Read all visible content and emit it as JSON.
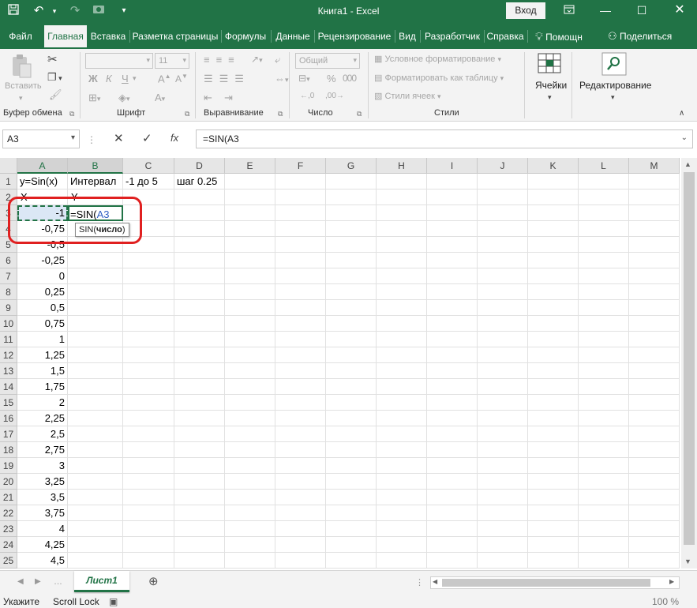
{
  "titlebar": {
    "title": "Книга1  -  Excel",
    "login": "Вход"
  },
  "tabs": [
    "Файл",
    "Главная",
    "Вставка",
    "Разметка страницы",
    "Формулы",
    "Данные",
    "Рецензирование",
    "Вид",
    "Разработчик",
    "Справка",
    "Помощн",
    "Поделиться"
  ],
  "ribbon": {
    "paste": "Вставить",
    "clipboard": "Буфер обмена",
    "font_size": "11",
    "font": "Шрифт",
    "alignment": "Выравнивание",
    "number_format": "Общий",
    "number": "Число",
    "cond_format": "Условное форматирование",
    "format_table": "Форматировать как таблицу",
    "cell_styles": "Стили ячеек",
    "styles": "Стили",
    "cells": "Ячейки",
    "editing": "Редактирование"
  },
  "formula_bar": {
    "name_box": "A3",
    "formula": "=SIN(A3"
  },
  "columns": [
    "A",
    "B",
    "C",
    "D",
    "E",
    "F",
    "G",
    "H",
    "I",
    "J",
    "K",
    "L",
    "M"
  ],
  "rows": [
    "1",
    "2",
    "3",
    "4",
    "5",
    "6",
    "7",
    "8",
    "9",
    "10",
    "11",
    "12",
    "13",
    "14",
    "15",
    "16",
    "17",
    "18",
    "19",
    "20",
    "21",
    "22",
    "23",
    "24",
    "25"
  ],
  "cells": {
    "r1": {
      "a": "y=Sin(x)",
      "b": "Интервал",
      "c": "-1 до 5",
      "d": "шаг 0.25"
    },
    "r2": {
      "a": "X",
      "b": "Y"
    },
    "a_values": [
      "-1",
      "-0,75",
      "-0,5",
      "-0,25",
      "0",
      "0,25",
      "0,5",
      "0,75",
      "1",
      "1,25",
      "1,5",
      "1,75",
      "2",
      "2,25",
      "2,5",
      "2,75",
      "3",
      "3,25",
      "3,5",
      "3,75",
      "4",
      "4,25",
      "4,5"
    ],
    "b3_prefix": "=SIN(",
    "b3_ref": "A3",
    "tooltip_fn": "SIN(",
    "tooltip_arg": "число",
    "tooltip_end": ")"
  },
  "sheet_tab": "Лист1",
  "status": {
    "mode": "Укажите",
    "scroll": "Scroll Lock",
    "zoom": "100 %"
  },
  "colors": {
    "excel_green": "#217346",
    "highlight_red": "#e02020"
  }
}
